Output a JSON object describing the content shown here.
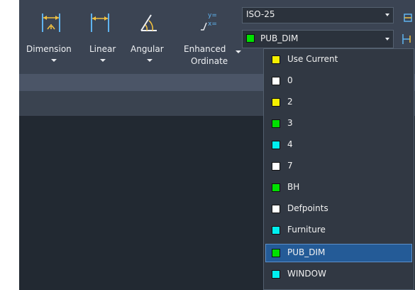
{
  "ribbon": {
    "tools": [
      {
        "label": "Dimension",
        "icon": "dimension-icon"
      },
      {
        "label": "Linear",
        "icon": "linear-dimension-icon"
      },
      {
        "label": "Angular",
        "icon": "angular-dimension-icon"
      },
      {
        "label_line1": "Enhanced",
        "label_line2": "Ordinate",
        "icon": "ordinate-dimension-icon"
      }
    ]
  },
  "dim_style": {
    "value": "ISO-25"
  },
  "layer_combo": {
    "value": "PUB_DIM",
    "swatch_color": "#00e000"
  },
  "layer_dropdown": {
    "items": [
      {
        "label": "Use Current",
        "color": "#f5f000"
      },
      {
        "label": "0",
        "color": "#ffffff"
      },
      {
        "label": "2",
        "color": "#f5f000"
      },
      {
        "label": "3",
        "color": "#00e000"
      },
      {
        "label": "4",
        "color": "#00f0f0"
      },
      {
        "label": "7",
        "color": "#ffffff"
      },
      {
        "label": "BH",
        "color": "#00e000"
      },
      {
        "label": "Defpoints",
        "color": "#ffffff"
      },
      {
        "label": "Furniture",
        "color": "#00f0f0"
      },
      {
        "label": "PUB_DIM",
        "color": "#00e000",
        "selected": true
      },
      {
        "label": "WINDOW",
        "color": "#00f0f0"
      }
    ]
  },
  "colors": {
    "accent": "#245b97",
    "icon_blue": "#5fb3f0",
    "icon_yellow": "#f0c040"
  }
}
